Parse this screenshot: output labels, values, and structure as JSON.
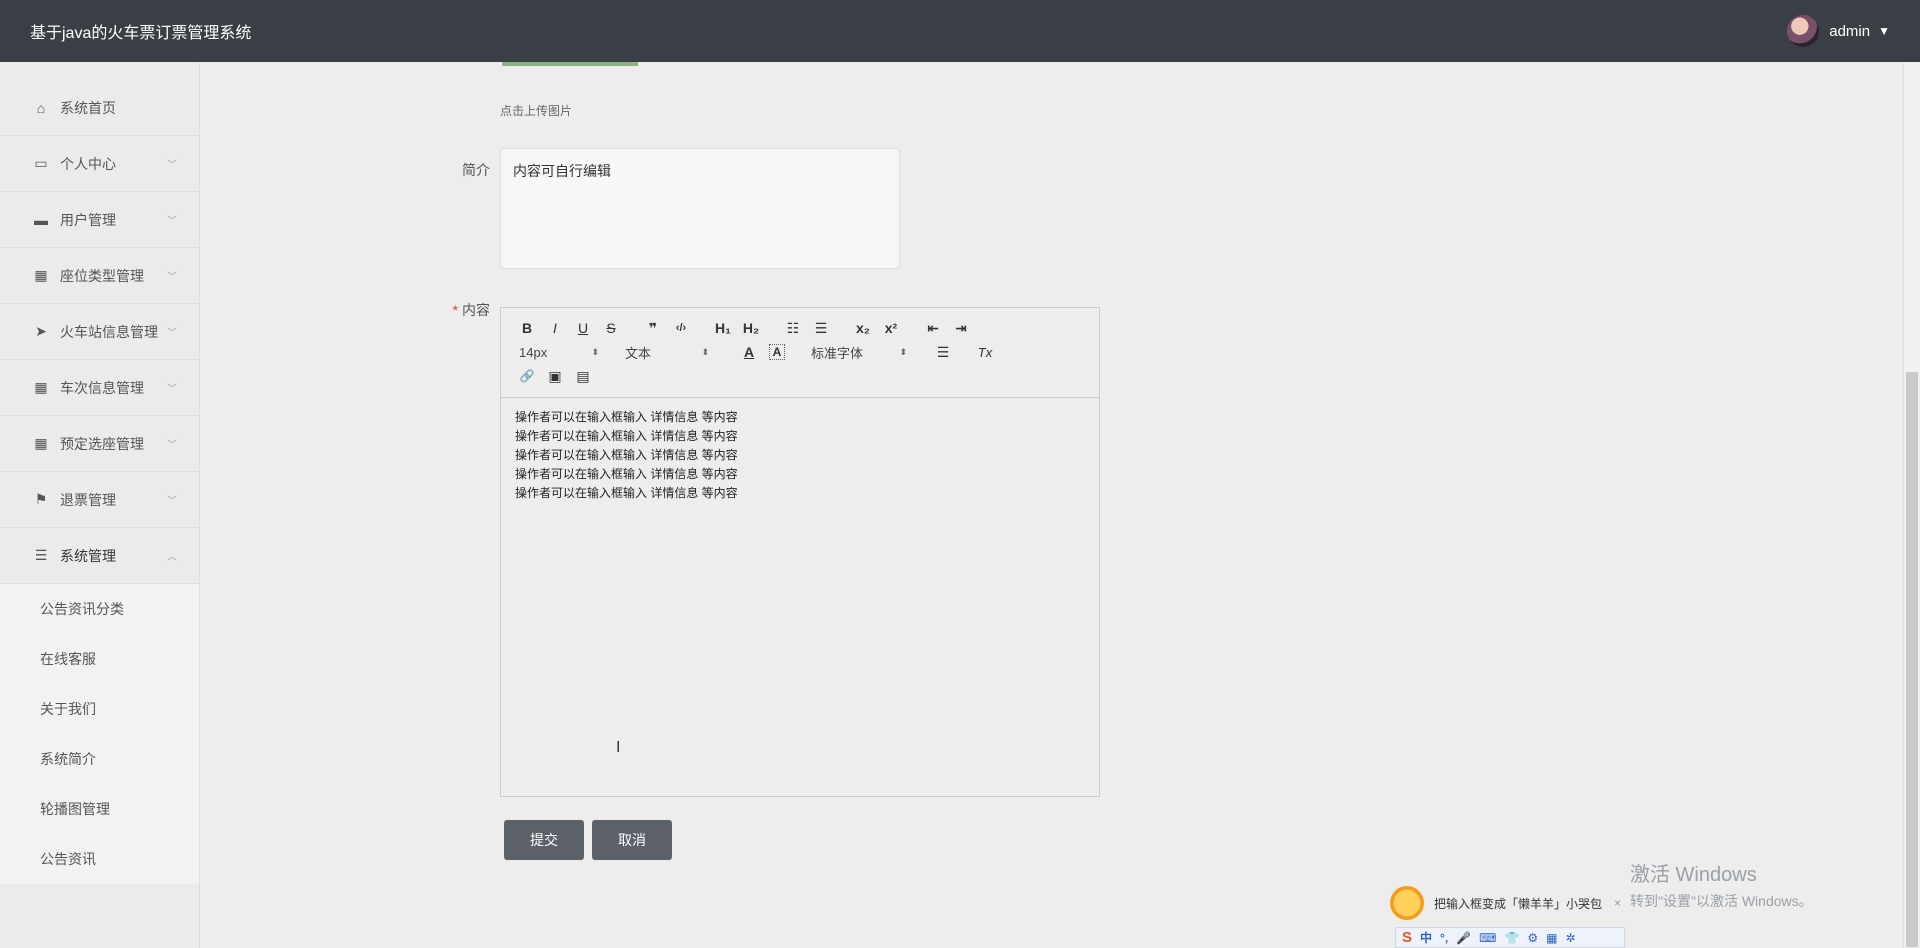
{
  "header": {
    "title": "基于java的火车票订票管理系统",
    "user": "admin",
    "caret": "▼"
  },
  "sidebar": {
    "items": [
      {
        "label": "系统首页",
        "icon": "⌂",
        "arrow": ""
      },
      {
        "label": "个人中心",
        "icon": "▭",
        "arrow": "﹀"
      },
      {
        "label": "用户管理",
        "icon": "▬",
        "arrow": "﹀"
      },
      {
        "label": "座位类型管理",
        "icon": "▦",
        "arrow": "﹀"
      },
      {
        "label": "火车站信息管理",
        "icon": "➤",
        "arrow": "﹀"
      },
      {
        "label": "车次信息管理",
        "icon": "▦",
        "arrow": "﹀"
      },
      {
        "label": "预定选座管理",
        "icon": "▦",
        "arrow": "﹀"
      },
      {
        "label": "退票管理",
        "icon": "⚑",
        "arrow": "﹀"
      },
      {
        "label": "系统管理",
        "icon": "☰",
        "arrow": "︿"
      }
    ],
    "sub_items": [
      "公告资讯分类",
      "在线客服",
      "关于我们",
      "系统简介",
      "轮播图管理",
      "公告资讯"
    ]
  },
  "form": {
    "upload_hint": "点击上传图片",
    "intro_label": "简介",
    "intro_value": "内容可自行编辑",
    "content_label": "内容",
    "required_mark": "*",
    "content_lines": [
      "操作者可以在输入框输入  详情信息  等内容",
      "操作者可以在输入框输入  详情信息  等内容",
      "操作者可以在输入框输入  详情信息  等内容",
      "操作者可以在输入框输入  详情信息  等内容",
      "操作者可以在输入框输入  详情信息  等内容"
    ],
    "submit_label": "提交",
    "cancel_label": "取消"
  },
  "editor": {
    "row1": [
      "B",
      "I",
      "U",
      "S",
      "❞",
      "‹/›",
      "H₁",
      "H₂",
      "☷",
      "☰",
      "x₂",
      "x²",
      "⇤",
      "⇥"
    ],
    "size_value": "14px",
    "block_value": "文本",
    "font_value": "标准字体",
    "color_icon": "A",
    "bg_icon": "A",
    "align_icon": "☰",
    "clear_icon": "Tx",
    "select_arrow": "⬍",
    "row3": [
      "🔗",
      "▣",
      "▤"
    ]
  },
  "watermark": {
    "line1": "激活 Windows",
    "line2": "转到\"设置\"以激活 Windows。"
  },
  "ime": {
    "tip": "把输入框变成「懒羊羊」小哭包",
    "close": "×",
    "logo": "S",
    "items": [
      "中",
      "°,",
      "🎤",
      "⌨",
      "👕",
      "⚙",
      "▦",
      "✲"
    ]
  },
  "cursor": "I",
  "icons": {
    "avatar": "avatar",
    "sun": "sun-icon"
  }
}
